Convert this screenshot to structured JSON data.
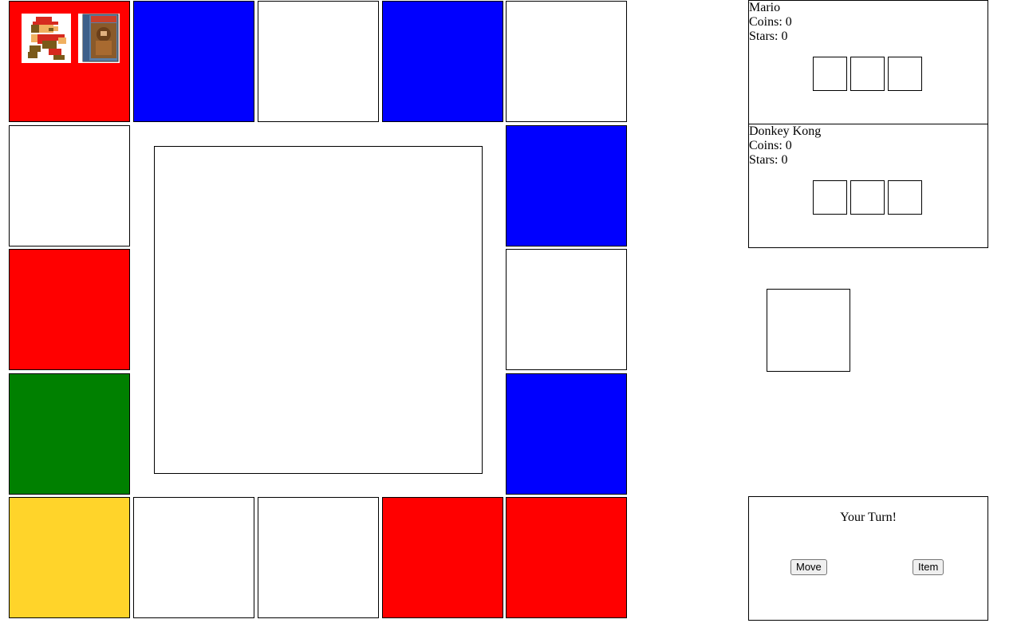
{
  "colors": {
    "red": "#ff0000",
    "blue": "#0000ff",
    "white": "#ffffff",
    "green": "#008000",
    "yellow": "#ffd42a"
  },
  "board": {
    "tiles": [
      {
        "id": "r0c0",
        "color": "#ff0000"
      },
      {
        "id": "r0c1",
        "color": "#0000ff"
      },
      {
        "id": "r0c2",
        "color": "#ffffff"
      },
      {
        "id": "r0c3",
        "color": "#0000ff"
      },
      {
        "id": "r0c4",
        "color": "#ffffff"
      },
      {
        "id": "r1c0",
        "color": "#ffffff"
      },
      {
        "id": "r1c4",
        "color": "#0000ff"
      },
      {
        "id": "r2c0",
        "color": "#ff0000"
      },
      {
        "id": "r2c4",
        "color": "#ffffff"
      },
      {
        "id": "r3c0",
        "color": "#008000"
      },
      {
        "id": "r3c4",
        "color": "#0000ff"
      },
      {
        "id": "r4c0",
        "color": "#ffd42a"
      },
      {
        "id": "r4c1",
        "color": "#ffffff"
      },
      {
        "id": "r4c2",
        "color": "#ffffff"
      },
      {
        "id": "r4c3",
        "color": "#ff0000"
      },
      {
        "id": "r4c4",
        "color": "#ff0000"
      }
    ],
    "tokens": [
      "mario-sprite",
      "donkey-kong-cartridge"
    ]
  },
  "players": [
    {
      "name": "Mario",
      "coins": "Coins: 0",
      "stars": "Stars: 0"
    },
    {
      "name": "Donkey Kong",
      "coins": "Coins: 0",
      "stars": "Stars: 0"
    }
  ],
  "actions": {
    "turn_text": "Your Turn!",
    "move_label": "Move",
    "item_label": "Item"
  }
}
